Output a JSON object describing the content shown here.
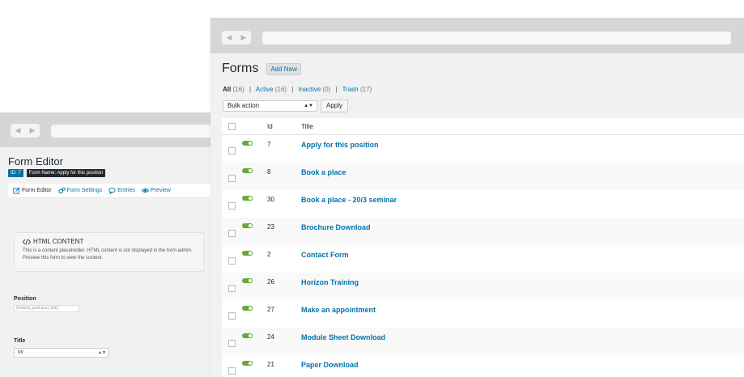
{
  "editor": {
    "title": "Form Editor",
    "id_badge": "ID: 7",
    "name_badge": "Form Name: Apply for this position",
    "tabs": [
      {
        "label": "Form Editor",
        "icon": "pencil-square-icon",
        "active": true
      },
      {
        "label": "Form Settings",
        "icon": "gears-icon",
        "active": false
      },
      {
        "label": "Entries",
        "icon": "speech-bubble-icon",
        "active": false
      },
      {
        "label": "Preview",
        "icon": "eye-icon",
        "active": false
      }
    ],
    "html_content": {
      "icon": "code-icon",
      "heading": "HTML CONTENT",
      "text": "This is a content placeholder. HTML content is not displayed in the form admin. Preview this form to view the content."
    },
    "position_label": "Position",
    "position_value": "{embed_post:post_title}",
    "title_label": "Title",
    "title_value": "Mr"
  },
  "forms": {
    "title": "Forms",
    "add_new": "Add New",
    "filters": [
      {
        "label": "All",
        "count": "(16)",
        "current": true
      },
      {
        "label": "Active",
        "count": "(16)",
        "current": false
      },
      {
        "label": "Inactive",
        "count": "(0)",
        "current": false
      },
      {
        "label": "Trash",
        "count": "(17)",
        "current": false
      }
    ],
    "bulk_action": "Bulk action",
    "apply": "Apply",
    "columns": {
      "id": "Id",
      "title": "Title"
    },
    "rows": [
      {
        "id": "7",
        "title": "Apply for this position",
        "active": true
      },
      {
        "id": "8",
        "title": "Book a place",
        "active": true
      },
      {
        "id": "30",
        "title": "Book a place - 20/3 seminar",
        "active": true
      },
      {
        "id": "23",
        "title": "Brochure Download",
        "active": true
      },
      {
        "id": "2",
        "title": "Contact Form",
        "active": true
      },
      {
        "id": "26",
        "title": "Horizon Training",
        "active": true
      },
      {
        "id": "27",
        "title": "Make an appointment",
        "active": true
      },
      {
        "id": "24",
        "title": "Module Sheet Download",
        "active": true
      },
      {
        "id": "21",
        "title": "Paper Download",
        "active": true
      }
    ]
  },
  "colors": {
    "link": "#0073aa",
    "toggle_active": "#66aa33",
    "chrome": "#d6d6d6"
  }
}
